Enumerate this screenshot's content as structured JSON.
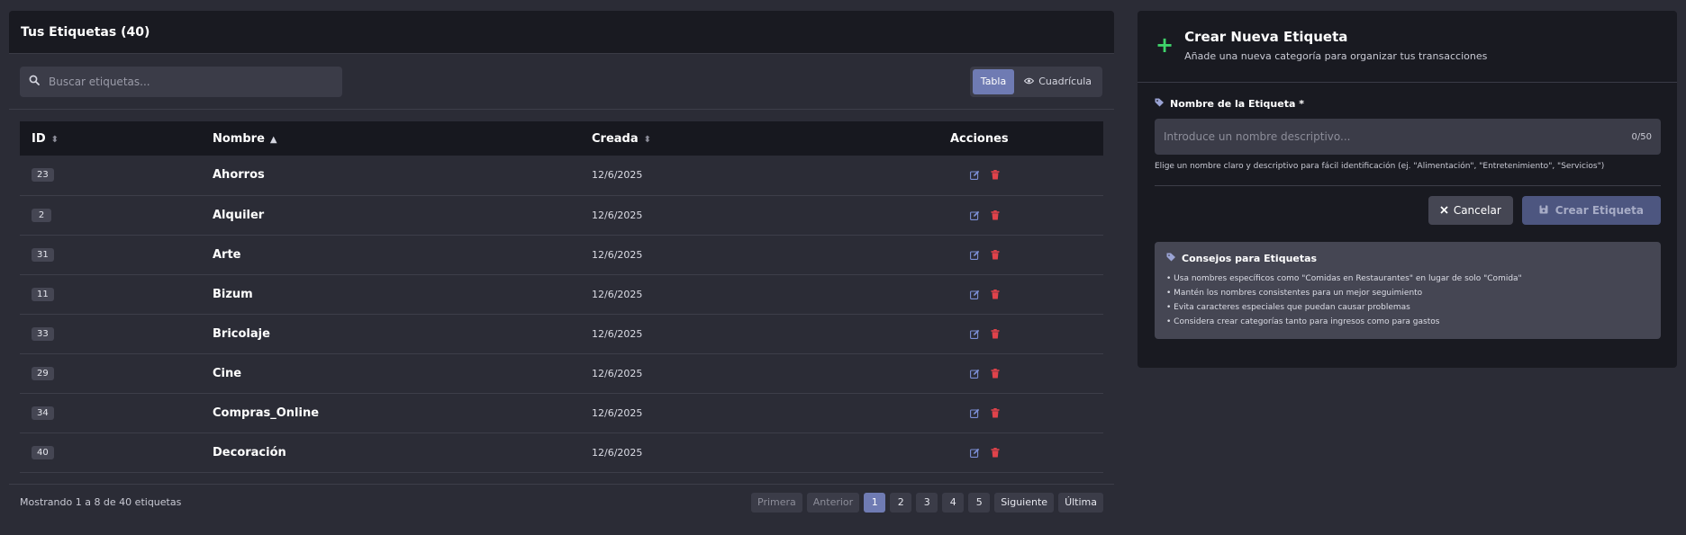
{
  "colors": {
    "background": "#2b2c36",
    "panel": "#191a21",
    "accent": "#6f7bb3",
    "plus_green": "#3fd46b",
    "delete_red": "#e0434b",
    "edit_blue": "#7c8fd6"
  },
  "left": {
    "title": "Tus Etiquetas (40)",
    "search_placeholder": "Buscar etiquetas...",
    "view_table_label": "Tabla",
    "view_grid_label": "Cuadrícula",
    "columns": {
      "id": "ID",
      "name": "Nombre",
      "created": "Creada",
      "actions": "Acciones"
    },
    "rows": [
      {
        "id": "23",
        "name": "Ahorros",
        "created": "12/6/2025"
      },
      {
        "id": "2",
        "name": "Alquiler",
        "created": "12/6/2025"
      },
      {
        "id": "31",
        "name": "Arte",
        "created": "12/6/2025"
      },
      {
        "id": "11",
        "name": "Bizum",
        "created": "12/6/2025"
      },
      {
        "id": "33",
        "name": "Bricolaje",
        "created": "12/6/2025"
      },
      {
        "id": "29",
        "name": "Cine",
        "created": "12/6/2025"
      },
      {
        "id": "34",
        "name": "Compras_Online",
        "created": "12/6/2025"
      },
      {
        "id": "40",
        "name": "Decoración",
        "created": "12/6/2025"
      }
    ],
    "footer_text": "Mostrando 1 a 8 de 40 etiquetas",
    "pagination": {
      "first": "Primera",
      "prev": "Anterior",
      "pages": [
        "1",
        "2",
        "3",
        "4",
        "5"
      ],
      "current_page": "1",
      "next": "Siguiente",
      "last": "Última"
    }
  },
  "right": {
    "title": "Crear Nueva Etiqueta",
    "subtitle": "Añade una nueva categoría para organizar tus transacciones",
    "field_label": "Nombre de la Etiqueta *",
    "input_placeholder": "Introduce un nombre descriptivo...",
    "char_count": "0/50",
    "help_text": "Elige un nombre claro y descriptivo para fácil identificación (ej. \"Alimentación\", \"Entretenimiento\", \"Servicios\")",
    "cancel_label": "Cancelar",
    "create_label": "Crear Etiqueta",
    "tips_title": "Consejos para Etiquetas",
    "tips": [
      "• Usa nombres específicos como \"Comidas en Restaurantes\" en lugar de solo \"Comida\"",
      "• Mantén los nombres consistentes para un mejor seguimiento",
      "• Evita caracteres especiales que puedan causar problemas",
      "• Considera crear categorías tanto para ingresos como para gastos"
    ]
  }
}
